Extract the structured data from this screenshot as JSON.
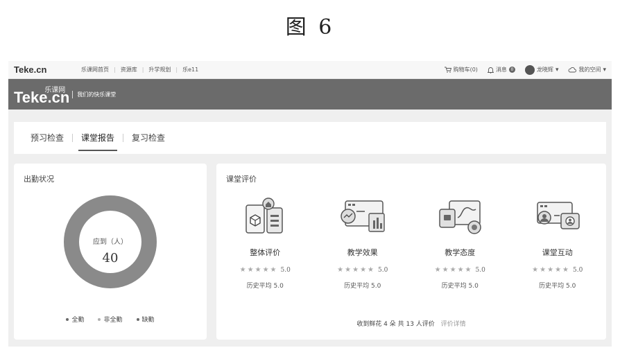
{
  "figure": {
    "caption": "图 6"
  },
  "topbar": {
    "logo": "Teke.cn",
    "nav": [
      "乐课网首页",
      "资源库",
      "升学规划",
      "乐e11"
    ],
    "cart": "购物车(0)",
    "message": "消息",
    "message_badge": "0",
    "user": "龙晓辉",
    "space": "我的空间"
  },
  "header": {
    "brand": "Teke.cn",
    "brand_cn": "乐课网",
    "slogan": "我们的快乐课堂"
  },
  "tabs": [
    {
      "label": "预习检查",
      "active": false
    },
    {
      "label": "课堂报告",
      "active": true
    },
    {
      "label": "复习检查",
      "active": false
    }
  ],
  "attendance": {
    "title": "出勤状况",
    "center_label": "应到（人）",
    "center_value": "40",
    "full_fraction": 1.0,
    "legend": [
      {
        "label": "全勤",
        "color": "#6a6a6a"
      },
      {
        "label": "非全勤",
        "color": "#b0b0b0"
      },
      {
        "label": "缺勤",
        "color": "#6a6a6a"
      }
    ],
    "ring_color": "#8a8a8a"
  },
  "evaluation": {
    "title": "课堂评价",
    "items": [
      {
        "name": "整体评价",
        "illus": "overall-evaluation-icon",
        "stars": 5,
        "score": "5.0",
        "history": "历史平均 5.0"
      },
      {
        "name": "教学效果",
        "illus": "teaching-effect-icon",
        "stars": 5,
        "score": "5.0",
        "history": "历史平均 5.0"
      },
      {
        "name": "教学态度",
        "illus": "teaching-attitude-icon",
        "stars": 5,
        "score": "5.0",
        "history": "历史平均 5.0"
      },
      {
        "name": "课堂互动",
        "illus": "class-interaction-icon",
        "stars": 5,
        "score": "5.0",
        "history": "历史平均 5.0"
      }
    ],
    "footer": "收到鲜花 4 朵  共 13 人评价",
    "footer_link": "评价详情"
  }
}
